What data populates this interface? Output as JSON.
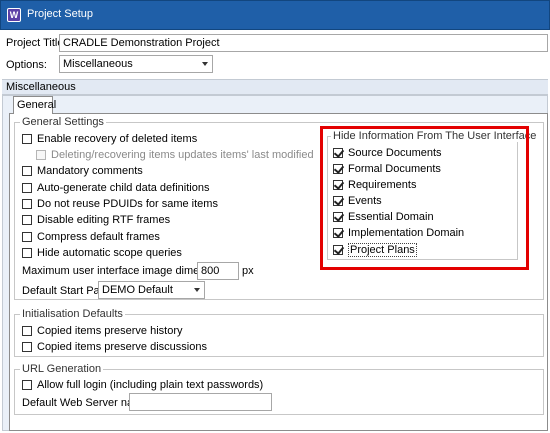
{
  "window": {
    "title": "Project Setup",
    "icon": "W"
  },
  "project_title": {
    "label": "Project Title:",
    "value": "CRADLE Demonstration Project"
  },
  "options": {
    "label": "Options:",
    "value": "Miscellaneous"
  },
  "section": {
    "title": "Miscellaneous"
  },
  "tabs": [
    {
      "label": "General"
    }
  ],
  "general_settings": {
    "title": "General Settings",
    "items": [
      {
        "label": "Enable recovery of deleted items",
        "checked": false
      },
      {
        "label": "Deleting/recovering items updates items' last modified information",
        "checked": false,
        "disabled": true
      },
      {
        "label": "Mandatory comments",
        "checked": false
      },
      {
        "label": "Auto-generate child data definitions",
        "checked": false
      },
      {
        "label": "Do not reuse PDUIDs for same items",
        "checked": false
      },
      {
        "label": "Disable editing RTF frames",
        "checked": false
      },
      {
        "label": "Compress default frames",
        "checked": false
      },
      {
        "label": "Hide automatic scope queries",
        "checked": false
      }
    ],
    "max_image_dim": {
      "label": "Maximum user interface image dimension",
      "value": "800",
      "unit": "px"
    },
    "default_start_page": {
      "label": "Default Start Page:",
      "value": "DEMO Default"
    }
  },
  "hide_info": {
    "title": "Hide Information From The User Interface",
    "items": [
      {
        "label": "Source Documents",
        "checked": true
      },
      {
        "label": "Formal Documents",
        "checked": true
      },
      {
        "label": "Requirements",
        "checked": true
      },
      {
        "label": "Events",
        "checked": true
      },
      {
        "label": "Essential Domain",
        "checked": true
      },
      {
        "label": "Implementation Domain",
        "checked": true
      },
      {
        "label": "Project Plans",
        "checked": true
      }
    ]
  },
  "init_defaults": {
    "title": "Initialisation Defaults",
    "items": [
      {
        "label": "Copied items preserve history",
        "checked": false
      },
      {
        "label": "Copied items preserve discussions",
        "checked": false
      }
    ]
  },
  "url_generation": {
    "title": "URL Generation",
    "items": [
      {
        "label": "Allow full login (including plain text passwords)",
        "checked": false
      }
    ],
    "web_server": {
      "label": "Default Web Server name:",
      "value": ""
    }
  },
  "colors": {
    "titlebar": "#1f5fa8",
    "highlight_border": "#e30000",
    "section_bg": "#e2e9f3"
  }
}
